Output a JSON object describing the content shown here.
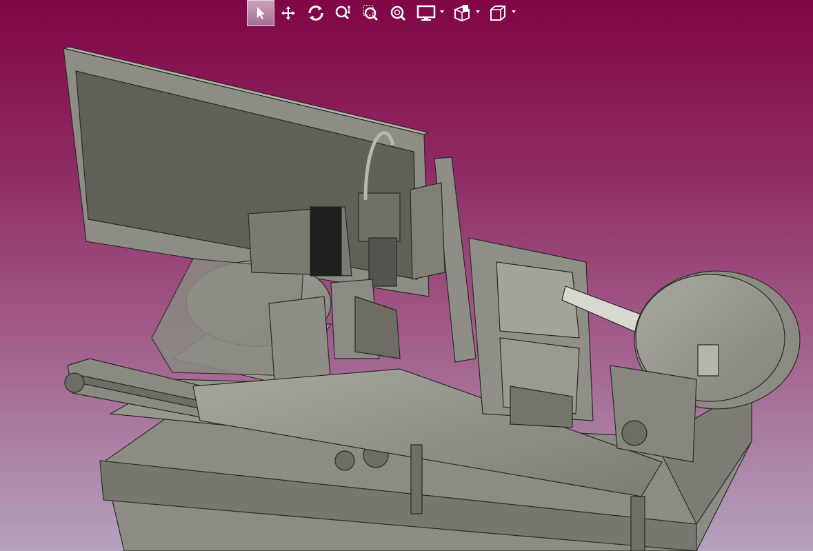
{
  "toolbar": {
    "tools": [
      {
        "name": "select-icon",
        "active": true
      },
      {
        "name": "pan-icon",
        "active": false
      },
      {
        "name": "rotate-icon",
        "active": false
      },
      {
        "name": "zoom-icon",
        "active": false
      },
      {
        "name": "zoom-area-icon",
        "active": false
      },
      {
        "name": "zoom-fit-icon",
        "active": false
      },
      {
        "name": "display-mode-icon",
        "dropdown": true
      },
      {
        "name": "section-view-icon",
        "dropdown": true
      },
      {
        "name": "view-cube-icon",
        "dropdown": true
      }
    ]
  },
  "colors": {
    "background_top": "#800546",
    "background_bottom": "#b4a2bf",
    "model_gray": "#8f8f87",
    "model_dark": "#5f6058",
    "model_light": "#b7b7ae"
  }
}
